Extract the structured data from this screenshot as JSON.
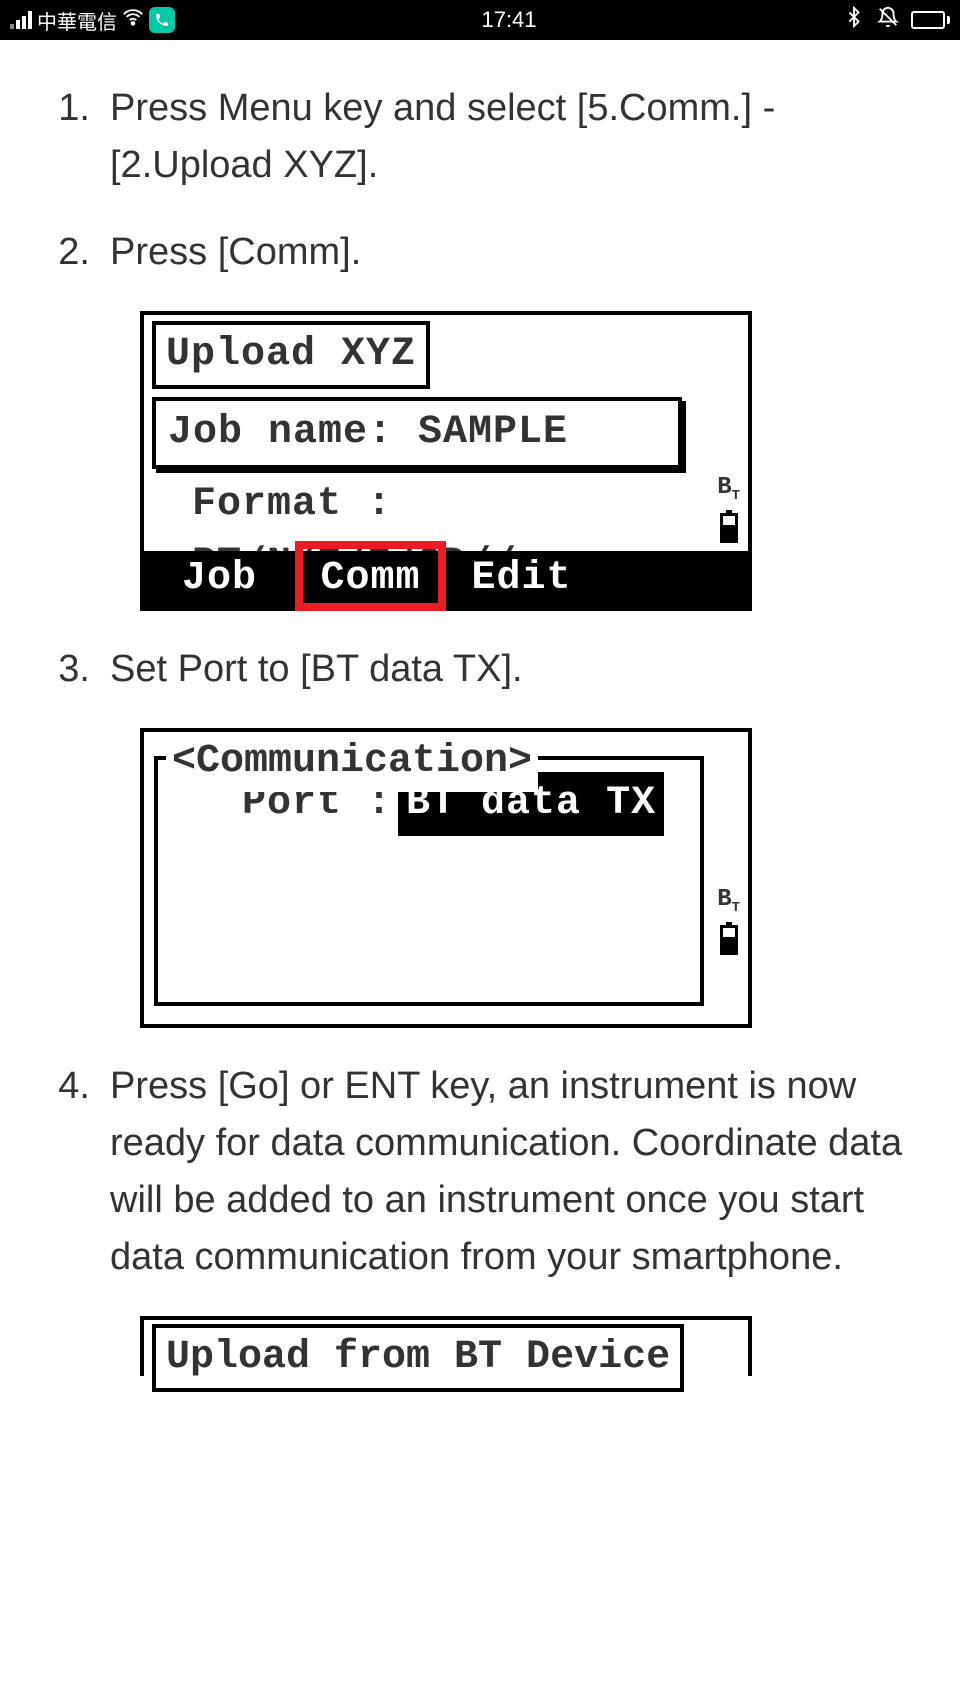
{
  "statusbar": {
    "carrier": "中華電信",
    "time": "17:41"
  },
  "steps": {
    "s1num": "1.",
    "s1text": "Press Menu key and select [5.Comm.] - [2.Upload XYZ].",
    "s2num": "2.",
    "s2text": "Press [Comm].",
    "s3num": "3.",
    "s3text": "Set Port to [BT data TX].",
    "s4num": "4.",
    "s4text": "Press [Go] or ENT key, an instrument is now ready for data communication. Coordinate data will be added to an instrument once you start data communication from your smartphone."
  },
  "screen1": {
    "title": "Upload XYZ",
    "jobname": "Job name: SAMPLE",
    "format": "Format : PT/N/E/Z/CD//",
    "softkey1": "Job",
    "softkey2": "Comm",
    "softkey3": "Edit"
  },
  "screen2": {
    "fieldset_label": "<Communication>",
    "port_label": "Port :",
    "port_value": "BT data TX"
  },
  "screen3": {
    "title": "Upload from BT Device"
  }
}
